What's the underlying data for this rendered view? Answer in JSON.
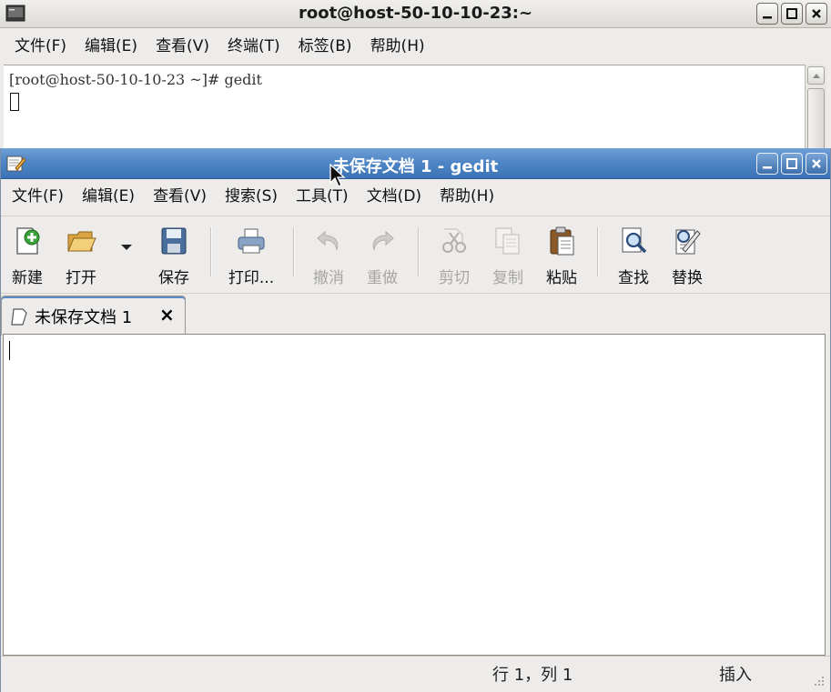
{
  "terminal": {
    "title": "root@host-50-10-10-23:~",
    "menu": [
      "文件(F)",
      "编辑(E)",
      "查看(V)",
      "终端(T)",
      "标签(B)",
      "帮助(H)"
    ],
    "prompt_line": "[root@host-50-10-10-23 ~]# gedit"
  },
  "gedit": {
    "title": "未保存文档 1 - gedit",
    "menu": [
      "文件(F)",
      "编辑(E)",
      "查看(V)",
      "搜索(S)",
      "工具(T)",
      "文档(D)",
      "帮助(H)"
    ],
    "toolbar": {
      "new": "新建",
      "open": "打开",
      "save": "保存",
      "print": "打印...",
      "undo": "撤消",
      "redo": "重做",
      "cut": "剪切",
      "copy": "复制",
      "paste": "粘贴",
      "find": "查找",
      "replace": "替换"
    },
    "tab": {
      "label": "未保存文档 1",
      "close": "×"
    },
    "editor_text": "",
    "status": {
      "position": "行 1，列 1",
      "mode": "插入"
    }
  },
  "colors": {
    "title_active": "#4f86c6",
    "window_bg": "#edeceb",
    "disabled_text": "#a8a6a2"
  }
}
